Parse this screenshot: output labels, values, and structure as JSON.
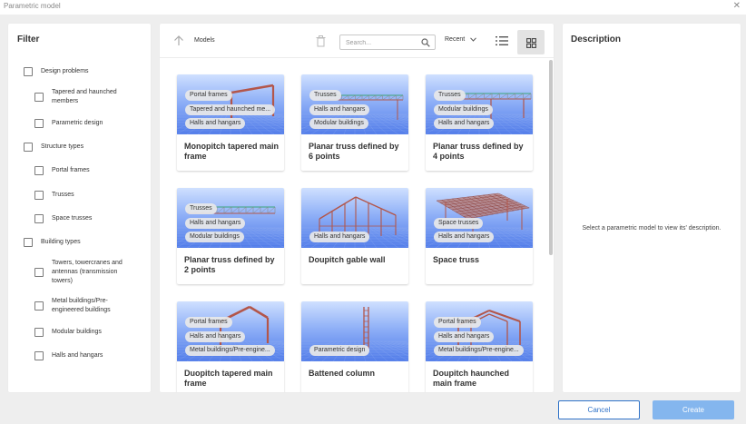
{
  "window": {
    "title": "Parametric model",
    "close_icon": "close-icon"
  },
  "filter": {
    "heading": "Filter",
    "items": [
      {
        "label": "Design problems",
        "level": 0
      },
      {
        "label": "Tapered and haunched members",
        "level": 1
      },
      {
        "label": "Parametric design",
        "level": 1
      },
      {
        "label": "Structure types",
        "level": 0
      },
      {
        "label": "Portal frames",
        "level": 1
      },
      {
        "label": "Trusses",
        "level": 1
      },
      {
        "label": "Space trusses",
        "level": 1
      },
      {
        "label": "Building types",
        "level": 0
      },
      {
        "label": "Towers, towercranes and antennas (transmission towers)",
        "level": 1
      },
      {
        "label": "Metal buildings/Pre-engineered buildings",
        "level": 1
      },
      {
        "label": "Modular buildings",
        "level": 1
      },
      {
        "label": "Halls and hangars",
        "level": 1
      }
    ]
  },
  "models": {
    "label": "Models",
    "search": {
      "placeholder": "Search..."
    },
    "sort": {
      "value": "Recent"
    },
    "view_mode": "grid",
    "cards": [
      {
        "name": "Monopitch tapered main frame",
        "tags": [
          "Portal frames",
          "Tapered and haunched me...",
          "Halls and hangars"
        ],
        "scene": "monopitch"
      },
      {
        "name": "Planar truss defined by 6 points",
        "tags": [
          "Trusses",
          "Halls and hangars",
          "Modular buildings"
        ],
        "scene": "truss6"
      },
      {
        "name": "Planar truss defined by 4 points",
        "tags": [
          "Trusses",
          "Modular buildings",
          "Halls and hangars"
        ],
        "scene": "truss4"
      },
      {
        "name": "Planar truss defined by 2 points",
        "tags": [
          "Trusses",
          "Halls and hangars",
          "Modular buildings"
        ],
        "scene": "truss2"
      },
      {
        "name": "Doupitch gable wall",
        "tags": [
          "Halls and hangars"
        ],
        "scene": "gable"
      },
      {
        "name": "Space truss",
        "tags": [
          "Space trusses",
          "Halls and hangars"
        ],
        "scene": "space"
      },
      {
        "name": "Duopitch tapered main frame",
        "tags": [
          "Portal frames",
          "Halls and hangars",
          "Metal buildings/Pre-engine..."
        ],
        "scene": "duotapered"
      },
      {
        "name": "Battened column",
        "tags": [
          "Parametric design"
        ],
        "scene": "column"
      },
      {
        "name": "Doupitch haunched main frame",
        "tags": [
          "Portal frames",
          "Halls and hangars",
          "Metal buildings/Pre-engine..."
        ],
        "scene": "duohaunched"
      }
    ]
  },
  "description": {
    "heading": "Description",
    "placeholder": "Select a parametric model to view its' description."
  },
  "actions": {
    "cancel_label": "Cancel",
    "create_label": "Create"
  },
  "colors": {
    "accent": "#2f72c8",
    "create_bg": "#84b6ee",
    "member": "#b3564a",
    "truss_chord": "#3aa57a"
  }
}
